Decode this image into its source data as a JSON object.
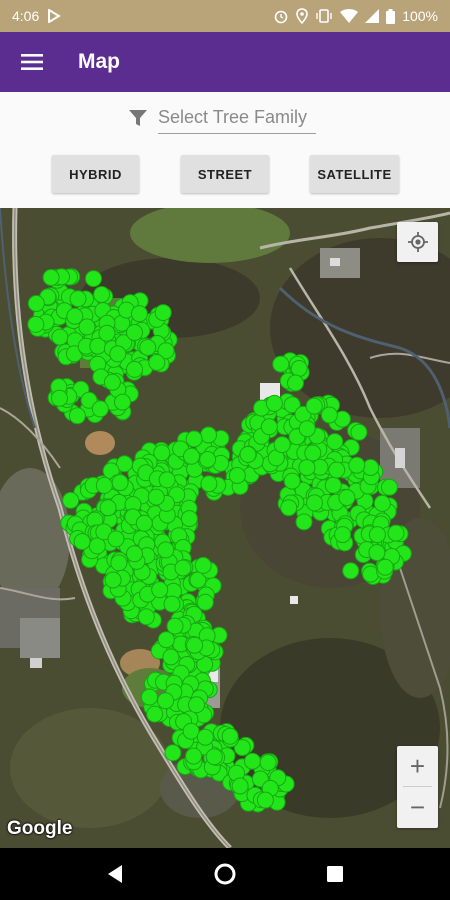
{
  "status_bar": {
    "time": "4:06",
    "battery": "100%",
    "icons": [
      "media-icon",
      "alarm-icon",
      "location-icon",
      "vibrate-icon",
      "wifi-icon",
      "signal-icon",
      "battery-icon"
    ]
  },
  "app_bar": {
    "title": "Map",
    "menu_icon": "hamburger-menu-icon",
    "color": "#5c2d91"
  },
  "filter": {
    "placeholder": "Select Tree Family",
    "icon": "filter-icon"
  },
  "map_types": {
    "hybrid": "HYBRID",
    "street": "STREET",
    "satellite": "SATELLITE"
  },
  "map": {
    "marker_color": "#22e61a",
    "attribution": "Google",
    "zoom_in": "+",
    "zoom_out": "−",
    "locate_icon": "my-location-icon"
  },
  "nav_bar": {
    "icons": [
      "back-icon",
      "home-icon",
      "recents-icon"
    ]
  }
}
